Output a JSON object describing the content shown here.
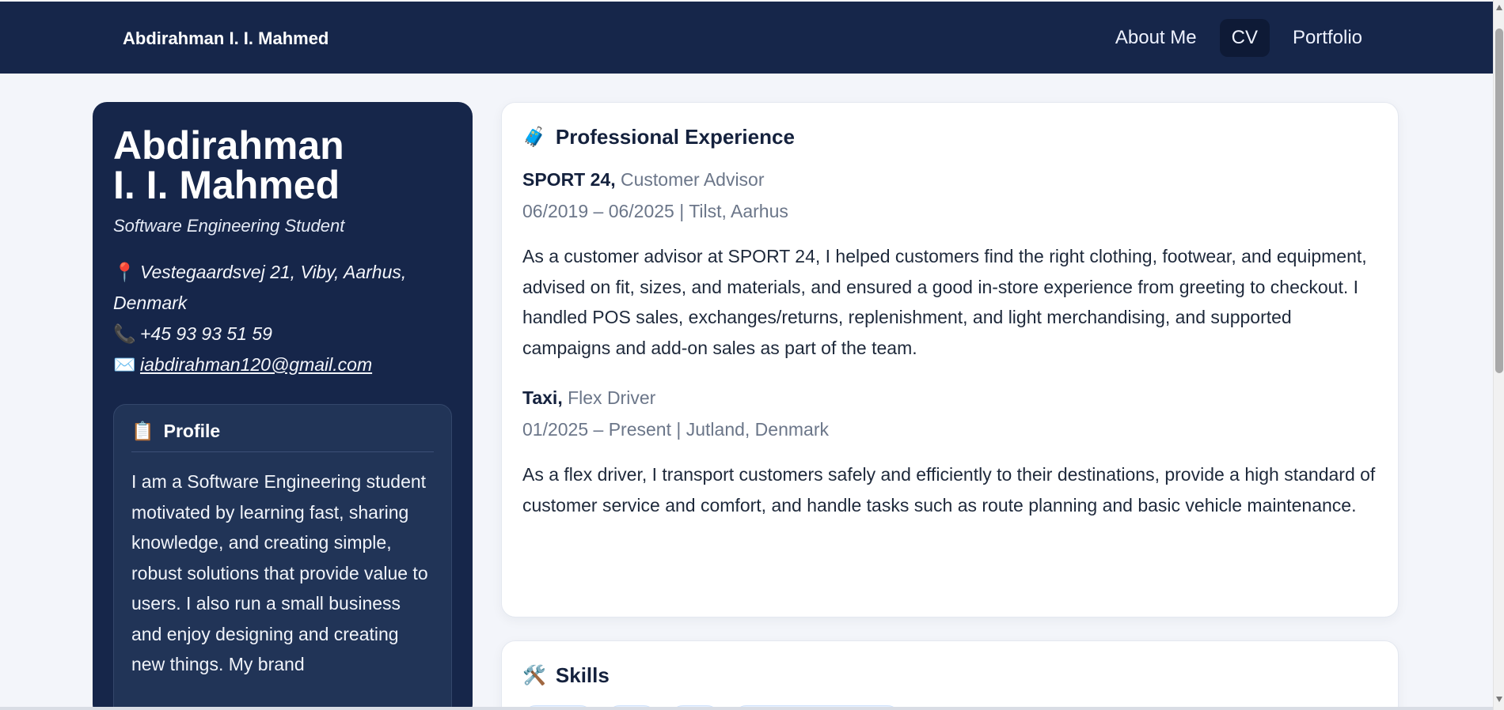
{
  "header": {
    "brand": "Abdirahman I. I. Mahmed",
    "nav": [
      {
        "label": "About Me",
        "active": false
      },
      {
        "label": "CV",
        "active": true
      },
      {
        "label": "Portfolio",
        "active": false
      }
    ]
  },
  "sidebar": {
    "name_line1": "Abdirahman",
    "name_line2": "I. I. Mahmed",
    "role": "Software Engineering Student",
    "address_icon": "📍",
    "address": "Vestegaardsvej 21, Viby, Aarhus, Denmark",
    "phone_icon": "📞",
    "phone": "+45 93 93 51 59",
    "email_icon": "✉️",
    "email": "iabdirahman120@gmail.com",
    "profile": {
      "icon": "📋",
      "title": "Profile",
      "text": "I am a Software Engineering student motivated by learning fast, sharing knowledge, and creating simple, robust solutions that provide value to users. I also run a small business and enjoy designing and creating new things. My brand"
    }
  },
  "experience": {
    "icon": "🧳",
    "title": "Professional Experience",
    "jobs": [
      {
        "employer": "SPORT 24,",
        "position": "Customer Advisor",
        "meta": "06/2019 – 06/2025 | Tilst, Aarhus",
        "description": "As a customer advisor at SPORT 24, I helped customers find the right clothing, footwear, and equipment, advised on fit, sizes, and materials, and ensured a good in-store experience from greeting to checkout. I handled POS sales, exchanges/returns, replenishment, and light merchandising, and supported campaigns and add-on sales as part of the team."
      },
      {
        "employer": "Taxi,",
        "position": "Flex Driver",
        "meta": "01/2025 – Present | Jutland, Denmark",
        "description": "As a flex driver, I transport customers safely and efficiently to their destinations, provide a high standard of customer service and comfort, and handle tasks such as route planning and basic vehicle maintenance."
      }
    ]
  },
  "skills": {
    "icon": "🛠️",
    "title": "Skills"
  },
  "colors": {
    "nav_bg": "#16264a",
    "page_bg": "#f3f5fa",
    "accent_chip": "#e7f1ff"
  }
}
